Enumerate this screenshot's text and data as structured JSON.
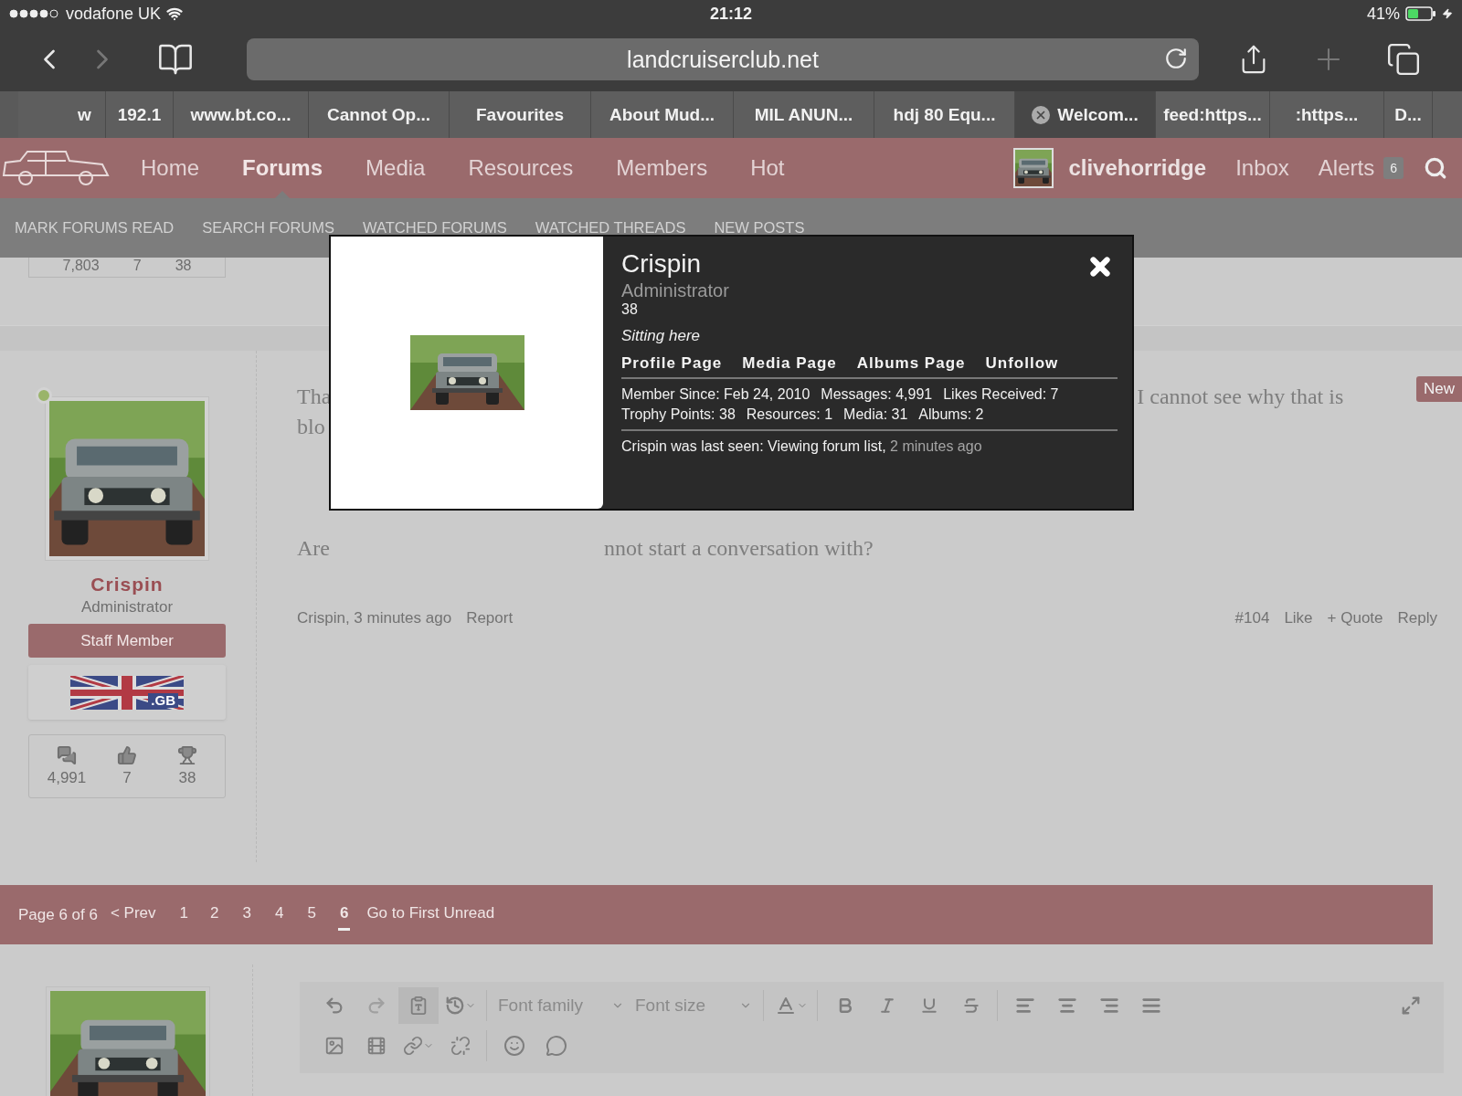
{
  "status_bar": {
    "carrier": "vodafone UK",
    "time": "21:12",
    "battery": "41%"
  },
  "browser": {
    "url": "landcruiserclub.net",
    "tabs": [
      {
        "label": "w",
        "selected": false
      },
      {
        "label": "192.1",
        "selected": false
      },
      {
        "label": "www.bt.co...",
        "selected": false
      },
      {
        "label": "Cannot Op...",
        "selected": false
      },
      {
        "label": "Favourites",
        "selected": false
      },
      {
        "label": "About Mud...",
        "selected": false
      },
      {
        "label": "MIL ANUN...",
        "selected": false
      },
      {
        "label": "hdj 80 Equ...",
        "selected": false
      },
      {
        "label": "Welcom...",
        "selected": true
      },
      {
        "label": "feed:https...",
        "selected": false
      },
      {
        "label": ":https...",
        "selected": false
      },
      {
        "label": "D...",
        "selected": false
      }
    ]
  },
  "site_nav": {
    "items": [
      {
        "label": "Home",
        "selected": false
      },
      {
        "label": "Forums",
        "selected": true
      },
      {
        "label": "Media",
        "selected": false
      },
      {
        "label": "Resources",
        "selected": false
      },
      {
        "label": "Members",
        "selected": false
      },
      {
        "label": "Hot",
        "selected": false
      }
    ],
    "username": "clivehorridge",
    "inbox": "Inbox",
    "alerts": "Alerts",
    "alerts_count": "6"
  },
  "sub_nav": [
    "MARK FORUMS READ",
    "SEARCH FORUMS",
    "WATCHED FORUMS",
    "WATCHED THREADS",
    "NEW POSTS"
  ],
  "previous_post_stats": [
    "7,803",
    "7",
    "38"
  ],
  "post": {
    "author": "Crispin",
    "role": "Administrator",
    "badge": "Staff Member",
    "flag_label": ".GB",
    "stats": [
      "4,991",
      "7",
      "38"
    ],
    "new_label": "New",
    "text_lines": [
      {
        "left": "Tha",
        "right": "I cannot see why that is"
      },
      {
        "left": "blo"
      },
      {
        "left": "Are",
        "right": "nnot start a conversation with?"
      }
    ],
    "byline": "Crispin, 3 minutes ago",
    "report": "Report",
    "number": "#104",
    "actions": [
      "Like",
      "+ Quote",
      "Reply"
    ]
  },
  "pagination": {
    "summary": "Page 6 of 6",
    "prev": "< Prev",
    "pages": [
      {
        "label": "1",
        "selected": false
      },
      {
        "label": "2",
        "selected": false
      },
      {
        "label": "3",
        "selected": false
      },
      {
        "label": "4",
        "selected": false
      },
      {
        "label": "5",
        "selected": false
      },
      {
        "label": "6",
        "selected": true
      }
    ],
    "first_unread": "Go to First Unread"
  },
  "editor": {
    "font_family": "Font family",
    "font_size": "Font size"
  },
  "member_popup": {
    "name": "Crispin",
    "title": "Administrator",
    "count": "38",
    "status": "Sitting here",
    "links": [
      "Profile Page",
      "Media Page",
      "Albums Page",
      "Unfollow"
    ],
    "stats_rows": [
      [
        "Member Since: Feb 24, 2010",
        "Messages: 4,991",
        "Likes Received: 7"
      ],
      [
        "Trophy Points: 38",
        "Resources: 1",
        "Media: 31",
        "Albums: 2"
      ]
    ],
    "last_seen": "Crispin was last seen: Viewing forum list,",
    "last_seen_time": "2 minutes ago"
  }
}
